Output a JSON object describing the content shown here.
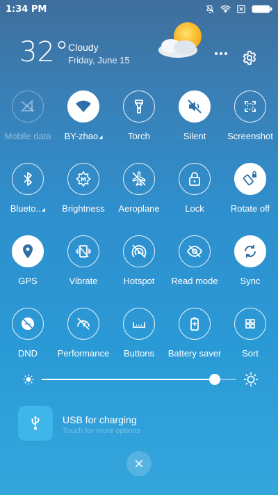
{
  "status_bar": {
    "time": "1:34 PM",
    "icons": [
      "notifications-muted-icon",
      "wifi-icon",
      "no-sim-icon",
      "battery-icon"
    ]
  },
  "weather": {
    "temperature": "32°",
    "condition": "Cloudy",
    "date": "Friday, June 15",
    "icon": "partly-cloudy-icon"
  },
  "header_actions": [
    "more-icon",
    "settings-gear-icon"
  ],
  "tiles": [
    {
      "label": "Mobile data",
      "icon": "mobile-data-off-icon",
      "state": "disabled"
    },
    {
      "label": "BY-zhao",
      "icon": "wifi-icon",
      "state": "active",
      "has_menu": true
    },
    {
      "label": "Torch",
      "icon": "torch-icon",
      "state": "off"
    },
    {
      "label": "Silent",
      "icon": "silent-icon",
      "state": "active"
    },
    {
      "label": "Screenshot",
      "icon": "screenshot-icon",
      "state": "off"
    },
    {
      "label": "Blueto..",
      "icon": "bluetooth-icon",
      "state": "off",
      "has_menu": true
    },
    {
      "label": "Brightness",
      "icon": "auto-brightness-icon",
      "state": "off"
    },
    {
      "label": "Aeroplane",
      "icon": "aeroplane-icon",
      "state": "off"
    },
    {
      "label": "Lock",
      "icon": "lock-icon",
      "state": "off"
    },
    {
      "label": "Rotate off",
      "icon": "rotate-lock-icon",
      "state": "active"
    },
    {
      "label": "GPS",
      "icon": "gps-icon",
      "state": "active"
    },
    {
      "label": "Vibrate",
      "icon": "vibrate-icon",
      "state": "off"
    },
    {
      "label": "Hotspot",
      "icon": "hotspot-icon",
      "state": "off"
    },
    {
      "label": "Read mode",
      "icon": "read-mode-icon",
      "state": "off"
    },
    {
      "label": "Sync",
      "icon": "sync-icon",
      "state": "active"
    },
    {
      "label": "DND",
      "icon": "dnd-icon",
      "state": "off"
    },
    {
      "label": "Performance",
      "icon": "performance-icon",
      "state": "off"
    },
    {
      "label": "Buttons",
      "icon": "buttons-icon",
      "state": "off"
    },
    {
      "label": "Battery saver",
      "icon": "battery-saver-icon",
      "state": "off"
    },
    {
      "label": "Sort",
      "icon": "sort-icon",
      "state": "off"
    }
  ],
  "brightness": {
    "level": 0.89
  },
  "notification": {
    "title": "USB for charging",
    "subtitle": "Touch for more options",
    "icon": "usb-icon"
  },
  "close_icon": "close-icon",
  "colors": {
    "background_top": "#3f6e9c",
    "background_bottom": "#34a6dc",
    "notification_icon_bg": "#3fb6ea"
  }
}
